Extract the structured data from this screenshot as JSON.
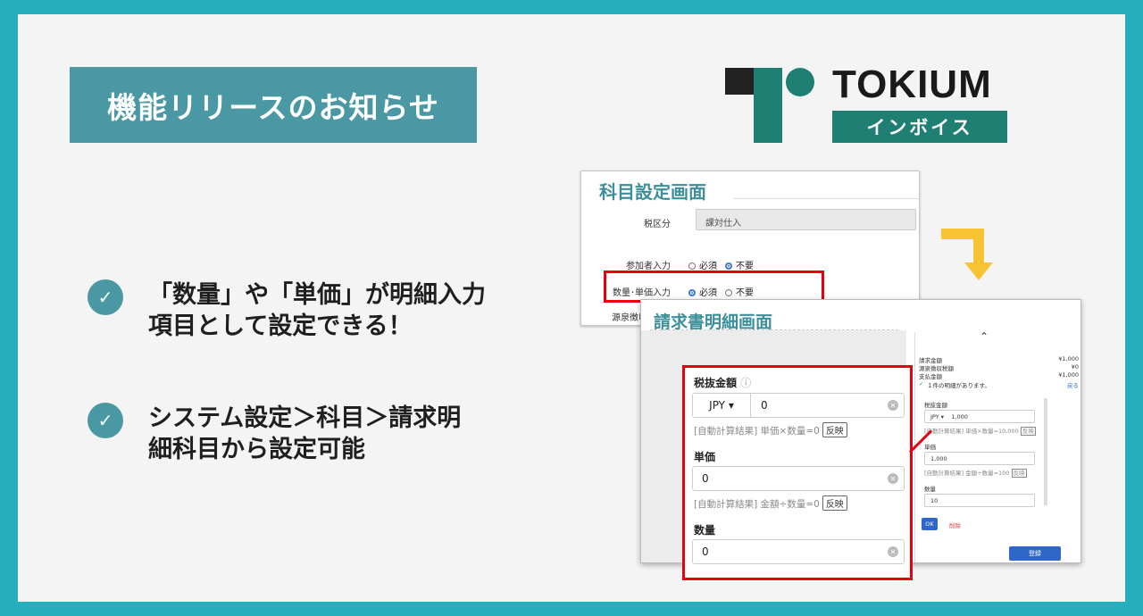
{
  "banner": {
    "title": "機能リリースのお知らせ"
  },
  "bullets": [
    {
      "line1": "「数量」や「単価」が明細入力",
      "line2": "項目として設定できる！"
    },
    {
      "line1": "システム設定＞科目＞請求明",
      "line2": "細科目から設定可能"
    }
  ],
  "logo": {
    "brand": "TOKIUM",
    "product": "インボイス"
  },
  "icons": {
    "check": "check-icon",
    "arrow": "arrow-down-icon",
    "clear": "clear-icon"
  },
  "colors": {
    "accent": "#4a98a3",
    "highlight": "#e60012",
    "arrow": "#f7c332",
    "border": "#25aebb"
  },
  "account_settings": {
    "title": "科目設定画面",
    "tax_label": "税区分",
    "tax_value": "課対仕入",
    "participant_label": "参加者入力",
    "qty_price_label": "数量･単価入力",
    "withholding_label": "源泉徴収対象",
    "required": "必須",
    "not_required": "不要"
  },
  "invoice_detail": {
    "title": "請求書明細画面",
    "tax_excluded_label": "税抜金額",
    "currency": "JPY",
    "amount_value": "0",
    "auto_calc_note_1": "[自動計算結果] 単価×数量=0",
    "reflect": "反映",
    "unit_price_label": "単価",
    "unit_price_value": "0",
    "auto_calc_note_2": "[自動計算結果] 金額÷数量=0",
    "quantity_label": "数量",
    "quantity_value": "0"
  },
  "side_panel": {
    "billing_label": "請求金額",
    "billing_value": "¥1,000",
    "withholding_label": "源泉徴収税額",
    "withholding_value": "¥0",
    "payment_label": "支払金額",
    "payment_value": "¥1,000",
    "detail_count": "１件の明細があります。",
    "back": "戻る",
    "tax_excluded_label": "税抜金額",
    "currency": "JPY",
    "amount_value": "1,000",
    "amount_note": "[自動計算結果] 単価×数量=10,000",
    "unit_price_label": "単価",
    "unit_price_value": "1,000",
    "unit_note": "[自動計算結果] 金額÷数量=100",
    "quantity_label": "数量",
    "quantity_value": "10",
    "reflect": "反映",
    "ok": "OK",
    "delete": "削除",
    "register": "登録"
  }
}
